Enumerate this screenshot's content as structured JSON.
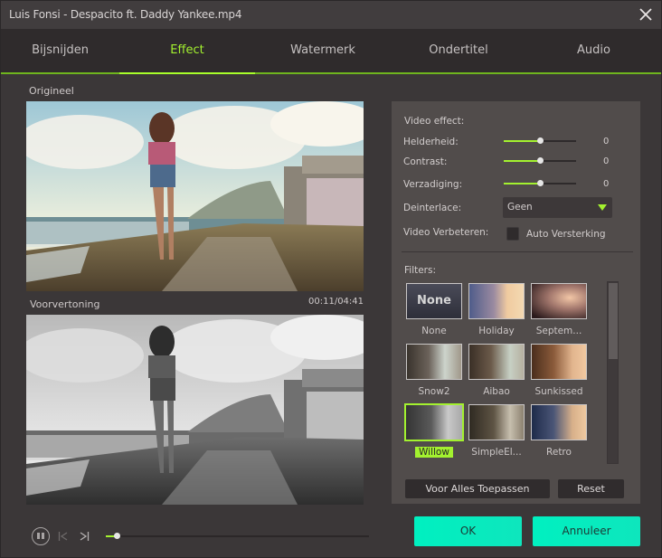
{
  "window": {
    "title": "Luis Fonsi - Despacito ft. Daddy Yankee.mp4",
    "close_icon": "close-icon"
  },
  "tabs": [
    {
      "label": "Bijsnijden",
      "active": false
    },
    {
      "label": "Effect",
      "active": true
    },
    {
      "label": "Watermerk",
      "active": false
    },
    {
      "label": "Ondertitel",
      "active": false
    },
    {
      "label": "Audio",
      "active": false
    }
  ],
  "preview": {
    "original_label": "Origineel",
    "preview_label": "Voorvertoning",
    "timecode": "00:11/04:41",
    "playback_progress": 0.04
  },
  "effects": {
    "heading": "Video effect:",
    "brightness": {
      "label": "Helderheid:",
      "value": "0",
      "position": 0.5
    },
    "contrast": {
      "label": "Contrast:",
      "value": "0",
      "position": 0.5
    },
    "saturation": {
      "label": "Verzadiging:",
      "value": "0",
      "position": 0.5
    },
    "deinterlace": {
      "label": "Deinterlace:",
      "selected": "Geen"
    },
    "enhance": {
      "label": "Video Verbeteren:",
      "checkbox_label": "Auto Versterking",
      "checked": false
    }
  },
  "filters": {
    "heading": "Filters:",
    "none_text": "None",
    "items": [
      {
        "label": "None"
      },
      {
        "label": "Holiday"
      },
      {
        "label": "Septem..."
      },
      {
        "label": "Snow2"
      },
      {
        "label": "Aibao"
      },
      {
        "label": "Sunkissed"
      },
      {
        "label": "Willow",
        "selected": true
      },
      {
        "label": "SimpleEl..."
      },
      {
        "label": "Retro"
      }
    ],
    "scroll_fraction": 0.42
  },
  "buttons": {
    "apply_all": "Voor Alles Toepassen",
    "reset": "Reset",
    "ok": "OK",
    "cancel": "Annuleer"
  },
  "colors": {
    "accent": "#a3f12f",
    "primary_button": "#00f0c0",
    "panel": "#514c4b",
    "background": "#3b3738"
  }
}
